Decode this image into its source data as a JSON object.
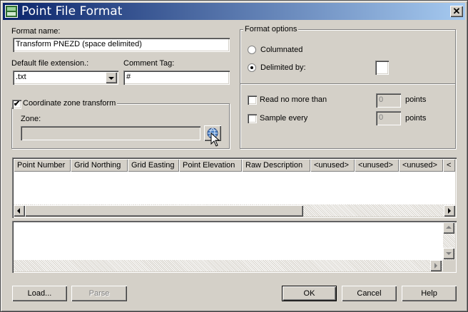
{
  "window": {
    "title": "Point File Format",
    "close_glyph": "✕"
  },
  "format": {
    "name_label": "Format name:",
    "name_value": "Transform PNEZD (space delimited)",
    "ext_label": "Default file extension.:",
    "ext_value": ".txt",
    "comment_label": "Comment Tag:",
    "comment_value": "#"
  },
  "coord": {
    "checkbox_label": "Coordinate zone transform",
    "checked": true,
    "check_glyph": "✔",
    "zone_label": "Zone:",
    "zone_value": "",
    "zone_button_icon": "globe-icon"
  },
  "options": {
    "title": "Format options",
    "columnated_label": "Columnated",
    "delimited_label": "Delimited by:",
    "selected": "delimited",
    "delimiter_value": "",
    "read_label": "Read no more than",
    "read_value": "0",
    "read_unit": "points",
    "sample_label": "Sample every",
    "sample_value": "0",
    "sample_unit": "points"
  },
  "columns": [
    "Point Number",
    "Grid Northing",
    "Grid Easting",
    "Point Elevation",
    "Raw Description",
    "<unused>",
    "<unused>",
    "<unused>",
    "<"
  ],
  "buttons": {
    "load": "Load...",
    "parse": "Parse",
    "ok": "OK",
    "cancel": "Cancel",
    "help": "Help"
  },
  "colors": {
    "title_start": "#0a246a",
    "title_end": "#a6caf0",
    "face": "#d4d0c8"
  }
}
